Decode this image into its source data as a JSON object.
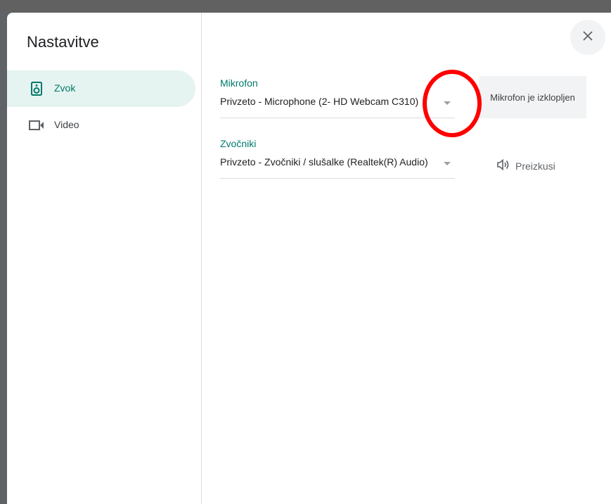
{
  "dialog": {
    "title": "Nastavitve",
    "close_icon": "close-icon"
  },
  "sidebar": {
    "items": [
      {
        "label": "Zvok",
        "icon": "speaker-icon",
        "active": true
      },
      {
        "label": "Video",
        "icon": "videocam-icon",
        "active": false
      }
    ]
  },
  "audio": {
    "microphone": {
      "label": "Mikrofon",
      "value": "Privzeto - Microphone (2- HD Webcam C310)"
    },
    "mic_status": "Mikrofon je izklopljen",
    "speakers": {
      "label": "Zvočniki",
      "value": "Privzeto - Zvočniki / slušalke (Realtek(R) Audio)"
    },
    "test_label": "Preizkusi",
    "test_icon": "volume-icon"
  },
  "colors": {
    "accent": "#00796b",
    "active_bg": "#e6f4f1",
    "annotation": "#ff0000"
  }
}
